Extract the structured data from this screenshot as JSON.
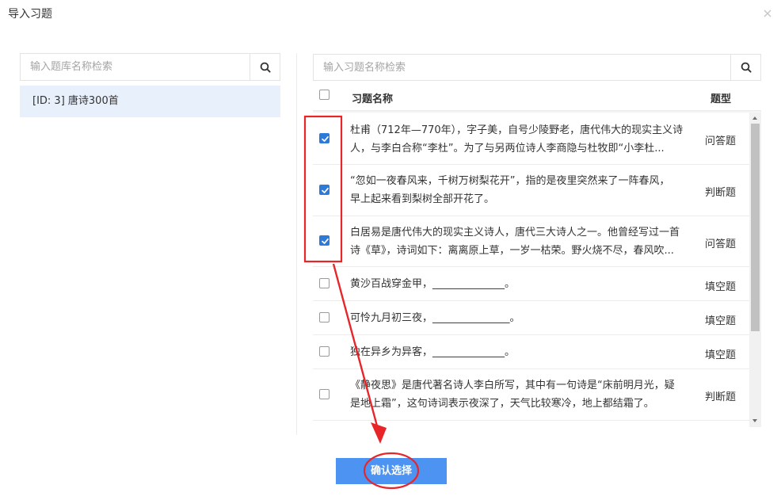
{
  "dialog": {
    "title": "导入习题",
    "close_icon": "close-icon"
  },
  "library_panel": {
    "search_placeholder": "输入题库名称检索",
    "items": [
      {
        "label": "[ID: 3] 唐诗300首",
        "selected": true
      }
    ]
  },
  "question_panel": {
    "search_placeholder": "输入习题名称检索",
    "columns": {
      "name": "习题名称",
      "type": "题型"
    },
    "rows": [
      {
        "checked": true,
        "name_lines": [
          "杜甫（712年—770年），字子美，自号少陵野老，唐代伟大的现实主义诗",
          "人，与李白合称“李杜”。为了与另两位诗人李商隐与杜牧即“小李杜..."
        ],
        "type": "问答题"
      },
      {
        "checked": true,
        "name_lines": [
          "“忽如一夜春风来，千树万树梨花开”，指的是夜里突然来了一阵春风，",
          "早上起来看到梨树全部开花了。"
        ],
        "type": "判断题"
      },
      {
        "checked": true,
        "name_lines": [
          "白居易是唐代伟大的现实主义诗人，唐代三大诗人之一。他曾经写过一首",
          "诗《草》，诗词如下：离离原上草，一岁一枯荣。野火烧不尽，春风吹..."
        ],
        "type": "问答题"
      },
      {
        "checked": false,
        "name_lines": [
          "黄沙百战穿金甲，______________。"
        ],
        "type": "填空题"
      },
      {
        "checked": false,
        "name_lines": [
          "可怜九月初三夜，_______________。"
        ],
        "type": "填空题"
      },
      {
        "checked": false,
        "name_lines": [
          "独在异乡为异客，______________。"
        ],
        "type": "填空题"
      },
      {
        "checked": false,
        "name_lines": [
          "《静夜思》是唐代著名诗人李白所写，其中有一句诗是“床前明月光，疑",
          "是地上霜”，这句诗词表示夜深了，天气比较寒冷，地上都结霜了。"
        ],
        "type": "判断题"
      }
    ]
  },
  "confirm_button": {
    "label": "确认选择"
  },
  "colors": {
    "accent": "#4d94f2",
    "checkbox": "#2e7ad8",
    "selected_bg": "#e8f0fc",
    "annotation": "#e8262a"
  }
}
